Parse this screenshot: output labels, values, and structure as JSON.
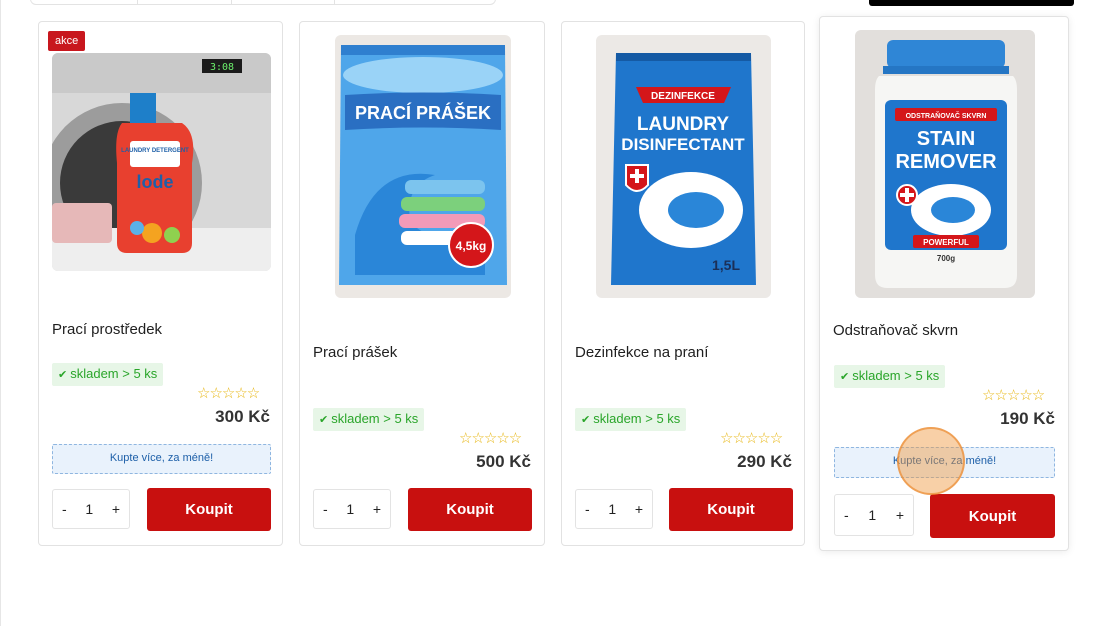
{
  "products": [
    {
      "badge": "akce",
      "image_label": "LAUNDRY DETERGENT",
      "image_brand": "lode",
      "title": "Prací prostředek",
      "stock": "skladem > 5 ks",
      "price": "300 Kč",
      "promo": "Kupte více, za méně!",
      "qty": "1",
      "buy_label": "Koupit"
    },
    {
      "image_label": "PRACÍ PRÁŠEK",
      "image_weight": "4,5kg",
      "title": "Prací prášek",
      "stock": "skladem > 5 ks",
      "price": "500 Kč",
      "qty": "1",
      "buy_label": "Koupit"
    },
    {
      "image_top": "DEZINFEKCE",
      "image_label_1": "LAUNDRY",
      "image_label_2": "DISINFECTANT",
      "image_volume": "1,5L",
      "title": "Dezinfekce na praní",
      "stock": "skladem > 5 ks",
      "price": "290 Kč",
      "qty": "1",
      "buy_label": "Koupit"
    },
    {
      "image_top": "ODSTRAŇOVAČ SKVRN",
      "image_label_1": "STAIN",
      "image_label_2": "REMOVER",
      "image_tag": "POWERFUL",
      "image_weight": "700g",
      "title": "Odstraňovač skvrn",
      "stock": "skladem > 5 ks",
      "price": "190 Kč",
      "promo": "Kupte více, za méně!",
      "qty": "1",
      "buy_label": "Koupit"
    }
  ],
  "qty_minus": "-",
  "qty_plus": "+",
  "rating_stars": "☆☆☆☆☆",
  "colors": {
    "accent": "#c8100f",
    "stock_green": "#2aa52a",
    "promo_blue": "#1d5fa8"
  }
}
